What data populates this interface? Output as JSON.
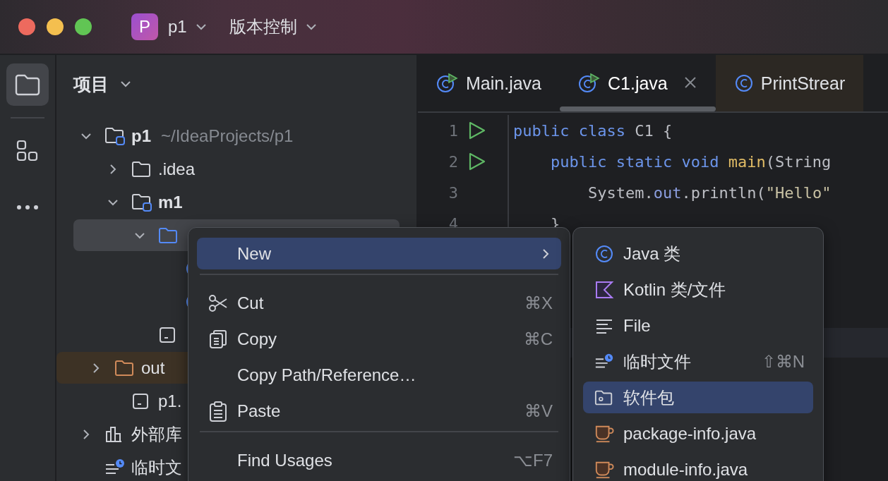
{
  "title_bar": {
    "project_badge": "P",
    "project": "p1",
    "vcs": "版本控制"
  },
  "tool_strip": {
    "items": [
      {
        "kind": "folder",
        "selected": true
      },
      {
        "kind": "structure",
        "selected": false
      },
      {
        "kind": "more",
        "selected": false
      }
    ]
  },
  "project_panel": {
    "title": "项目",
    "tree": [
      {
        "kind": "module",
        "name": "p1",
        "path": "~/IdeaProjects/p1",
        "expanded": true,
        "selected": false,
        "children": [
          {
            "kind": "folder",
            "name": ".idea",
            "expanded": false,
            "selected": false
          },
          {
            "kind": "module",
            "name": "m1",
            "expanded": true,
            "selected": false,
            "children": [
              {
                "kind": "source",
                "expanded": true,
                "selected": true,
                "children": [
                  {
                    "kind": "class",
                    "selected": false
                  },
                  {
                    "kind": "class",
                    "selected": false
                  }
                ]
              },
              {
                "kind": "iml",
                "selected": false
              }
            ]
          },
          {
            "kind": "excluded",
            "name": "out",
            "expanded": false,
            "selected": false
          },
          {
            "kind": "iml",
            "name": "p1.",
            "selected": false
          }
        ]
      },
      {
        "kind": "library",
        "name": "外部库",
        "expanded": false,
        "selected": false
      },
      {
        "kind": "scratch",
        "name": "临时文",
        "selected": false
      }
    ]
  },
  "editor": {
    "tabs": [
      {
        "kind": "runnable",
        "label": "Main.java",
        "selected": false
      },
      {
        "kind": "runnable",
        "label": "C1.java",
        "selected": true,
        "closable": true
      },
      {
        "kind": "library",
        "label": "PrintStrear",
        "selected": false
      }
    ],
    "lines": [
      {
        "number": "1",
        "runnable": true,
        "code": [
          {
            "kind": "keyword",
            "text": "public class"
          },
          {
            "kind": "plain",
            "text": " C1 {"
          }
        ]
      },
      {
        "number": "2",
        "runnable": true,
        "code": [
          {
            "kind": "keyword",
            "text": "    public static void"
          },
          {
            "kind": "method",
            "text": " main"
          },
          {
            "kind": "plain",
            "text": "(String"
          }
        ]
      },
      {
        "number": "3",
        "runnable": false,
        "code": [
          {
            "kind": "plain",
            "text": "        System."
          },
          {
            "kind": "field",
            "text": "out"
          },
          {
            "kind": "plain",
            "text": ".println("
          },
          {
            "kind": "string",
            "text": "\"Hello\""
          }
        ]
      },
      {
        "number": "4",
        "runnable": false,
        "code": [
          {
            "kind": "plain",
            "text": "    }"
          }
        ]
      }
    ]
  },
  "context_menu": {
    "items": [
      {
        "kind": "submenu",
        "label": "New",
        "selected": true
      },
      {
        "kind": "separator"
      },
      {
        "kind": "cut",
        "label": "Cut",
        "shortcut": "⌘X",
        "selected": false
      },
      {
        "kind": "copy",
        "label": "Copy",
        "shortcut": "⌘C",
        "selected": false
      },
      {
        "kind": "plain",
        "label": "Copy Path/Reference…",
        "selected": false
      },
      {
        "kind": "paste",
        "label": "Paste",
        "shortcut": "⌘V",
        "selected": false
      },
      {
        "kind": "separator"
      },
      {
        "kind": "plain",
        "label": "Find Usages",
        "shortcut": "⌥F7",
        "selected": false
      }
    ]
  },
  "submenu": {
    "items": [
      {
        "kind": "class",
        "label": "Java 类",
        "selected": false
      },
      {
        "kind": "kotlin",
        "label": "Kotlin 类/文件",
        "selected": false
      },
      {
        "kind": "text",
        "label": "File",
        "selected": false
      },
      {
        "kind": "scratch",
        "label": "临时文件",
        "shortcut": "⇧⌘N",
        "selected": false
      },
      {
        "kind": "package",
        "label": "软件包",
        "selected": true
      },
      {
        "kind": "java",
        "label": "package-info.java",
        "selected": false
      },
      {
        "kind": "java",
        "label": "module-info.java",
        "selected": false
      }
    ]
  }
}
